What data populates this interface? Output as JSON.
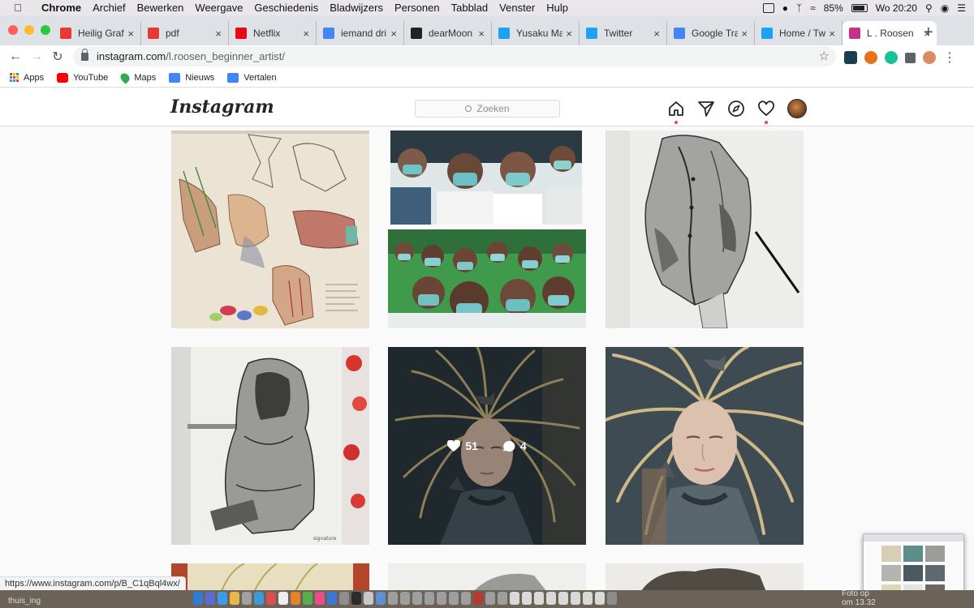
{
  "menubar": {
    "app": "Chrome",
    "items": [
      "Archief",
      "Bewerken",
      "Weergave",
      "Geschiedenis",
      "Bladwijzers",
      "Personen",
      "Tabblad",
      "Venster",
      "Hulp"
    ],
    "battery": "85%",
    "clock": "Wo 20:20"
  },
  "tabs": [
    {
      "title": "Heilig Grafi",
      "color": "#e53935",
      "letter": "S"
    },
    {
      "title": "pdf",
      "color": "#e53935",
      "letter": "S"
    },
    {
      "title": "Netflix",
      "color": "#e50914",
      "letter": "N"
    },
    {
      "title": "iemand dri",
      "color": "#4285f4",
      "letter": "G"
    },
    {
      "title": "dearMoon",
      "color": "#222222",
      "letter": "dM"
    },
    {
      "title": "Yusaku Ma",
      "color": "#1da1f2",
      "letter": "t"
    },
    {
      "title": "Twitter",
      "color": "#1da1f2",
      "letter": "t"
    },
    {
      "title": "Google Tra",
      "color": "#4285f4",
      "letter": "G"
    },
    {
      "title": "Home / Tw",
      "color": "#1da1f2",
      "letter": "t"
    },
    {
      "title": "L . Roosen",
      "color": "#c13584",
      "letter": "ig"
    }
  ],
  "omnibox": {
    "host": "instagram.com",
    "path": "/l.roosen_beginner_artist/"
  },
  "bookmarks": [
    {
      "label": "Apps"
    },
    {
      "label": "YouTube",
      "color": "#ff0000"
    },
    {
      "label": "Maps",
      "color": "#34a853"
    },
    {
      "label": "Nieuws",
      "color": "#4285f4"
    },
    {
      "label": "Vertalen",
      "color": "#4285f4"
    }
  ],
  "instagram": {
    "logo": "Instagram",
    "search_placeholder": "Zoeken"
  },
  "posts": [
    {
      "subject": "hand-anatomy-drawing",
      "palette": [
        "#e8e0cf",
        "#c9a184",
        "#7a8f6a"
      ]
    },
    {
      "subject": "masked-students-photo",
      "palette": [
        "#6fb7b8",
        "#2b3640",
        "#e9e3dc"
      ]
    },
    {
      "subject": "jacket-pencil-drawing",
      "palette": [
        "#eeeeec",
        "#777777",
        "#222222"
      ]
    },
    {
      "subject": "hoodie-pencil-drawing",
      "palette": [
        "#efefec",
        "#8a8a88",
        "#d5342f"
      ]
    },
    {
      "subject": "girl-with-golden-hair-painting",
      "palette": [
        "#2a3a42",
        "#c4b27a",
        "#d3b8a5"
      ],
      "likes": "51",
      "comments": "4"
    },
    {
      "subject": "girl-with-golden-hair-painting-closeup",
      "palette": [
        "#3c4a52",
        "#cbb985",
        "#dcc2ae"
      ]
    }
  ],
  "status_url": "https://www.instagram.com/p/B_C1qBql4wx/",
  "dock": {
    "label_right_1": "Foto op",
    "label_right_2": "om 13.32",
    "label_left": "thuis_ing"
  }
}
